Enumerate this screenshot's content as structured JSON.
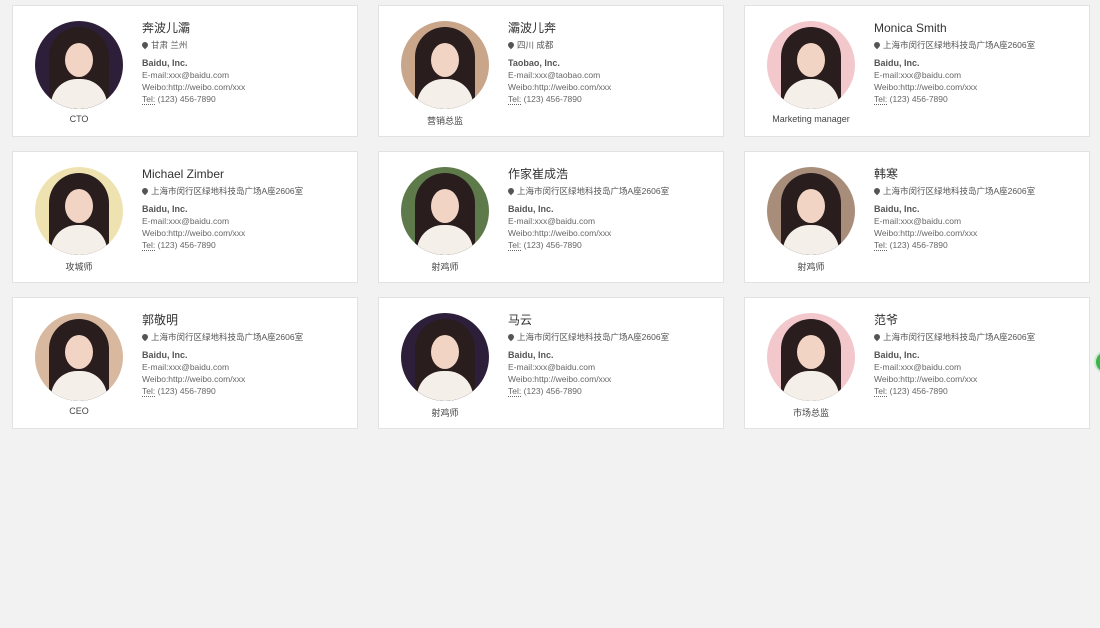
{
  "cards": [
    {
      "name": "奔波儿灞",
      "address": "甘肃 兰州",
      "company": "Baidu, Inc.",
      "email": "E-mail:xxx@baidu.com",
      "weibo": "Weibo:http://weibo.com/xxx",
      "tel_label": "Tel:",
      "tel": "(123) 456-7890",
      "role": "CTO",
      "avatar_color": "#2d1f3a"
    },
    {
      "name": "灞波儿奔",
      "address": "四川 成都",
      "company": "Taobao, Inc.",
      "email": "E-mail:xxx@taobao.com",
      "weibo": "Weibo:http://weibo.com/xxx",
      "tel_label": "Tel:",
      "tel": "(123) 456-7890",
      "role": "营销总监",
      "avatar_color": "#c9a68a"
    },
    {
      "name": "Monica Smith",
      "address": "上海市闵行区绿地科技岛广场A座2606室",
      "company": "Baidu, Inc.",
      "email": "E-mail:xxx@baidu.com",
      "weibo": "Weibo:http://weibo.com/xxx",
      "tel_label": "Tel:",
      "tel": "(123) 456-7890",
      "role": "Marketing manager",
      "avatar_color": "#f2c8cc"
    },
    {
      "name": "Michael Zimber",
      "address": "上海市闵行区绿地科技岛广场A座2606室",
      "company": "Baidu, Inc.",
      "email": "E-mail:xxx@baidu.com",
      "weibo": "Weibo:http://weibo.com/xxx",
      "tel_label": "Tel:",
      "tel": "(123) 456-7890",
      "role": "攻城师",
      "avatar_color": "#eee3b0"
    },
    {
      "name": "作家崔成浩",
      "address": "上海市闵行区绿地科技岛广场A座2606室",
      "company": "Baidu, Inc.",
      "email": "E-mail:xxx@baidu.com",
      "weibo": "Weibo:http://weibo.com/xxx",
      "tel_label": "Tel:",
      "tel": "(123) 456-7890",
      "role": "射鸡师",
      "avatar_color": "#5e7a4a"
    },
    {
      "name": "韩寒",
      "address": "上海市闵行区绿地科技岛广场A座2606室",
      "company": "Baidu, Inc.",
      "email": "E-mail:xxx@baidu.com",
      "weibo": "Weibo:http://weibo.com/xxx",
      "tel_label": "Tel:",
      "tel": "(123) 456-7890",
      "role": "射鸡师",
      "avatar_color": "#a88d7a"
    },
    {
      "name": "郭敬明",
      "address": "上海市闵行区绿地科技岛广场A座2606室",
      "company": "Baidu, Inc.",
      "email": "E-mail:xxx@baidu.com",
      "weibo": "Weibo:http://weibo.com/xxx",
      "tel_label": "Tel:",
      "tel": "(123) 456-7890",
      "role": "CEO",
      "avatar_color": "#d8b9a0"
    },
    {
      "name": "马云",
      "address": "上海市闵行区绿地科技岛广场A座2606室",
      "company": "Baidu, Inc.",
      "email": "E-mail:xxx@baidu.com",
      "weibo": "Weibo:http://weibo.com/xxx",
      "tel_label": "Tel:",
      "tel": "(123) 456-7890",
      "role": "射鸡师",
      "avatar_color": "#2d1f3a"
    },
    {
      "name": "范爷",
      "address": "上海市闵行区绿地科技岛广场A座2606室",
      "company": "Baidu, Inc.",
      "email": "E-mail:xxx@baidu.com",
      "weibo": "Weibo:http://weibo.com/xxx",
      "tel_label": "Tel:",
      "tel": "(123) 456-7890",
      "role": "市场总监",
      "avatar_color": "#f2c8cc"
    }
  ]
}
